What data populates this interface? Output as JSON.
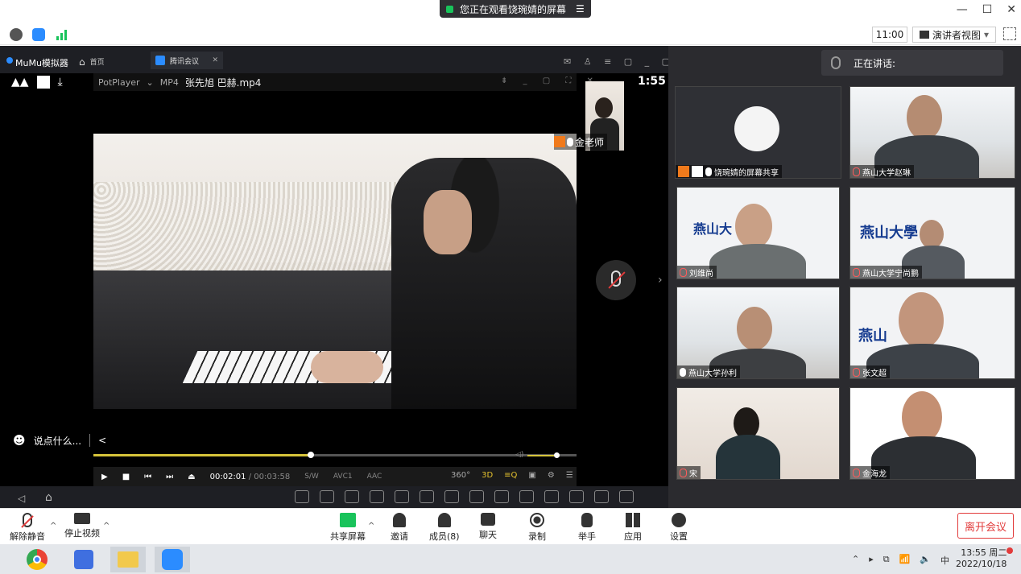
{
  "banner": {
    "text": "您正在观看饶琬婧的屏幕",
    "menu_glyph": "☰"
  },
  "window_controls": {
    "minimize": "—",
    "maximize": "☐",
    "close": "✕"
  },
  "toolbar": {
    "time": "11:00",
    "presenter_view": "演讲者视图",
    "presenter_caret": "▾"
  },
  "mumu": {
    "title": "MuMu模拟器",
    "home_tab": "首页",
    "meeting_tab": "腾讯会议",
    "tab_close": "✕",
    "controls": "✉ ♙ ≡ ▢ _ ▢ ✕"
  },
  "potplayer": {
    "app": "PotPlayer",
    "caret": "⌄",
    "format": "MP4",
    "file_title": "张先旭 巴赫.mp4",
    "controls": "⇟ _ ▢ ⛶ ✕"
  },
  "phone": {
    "clock": "1:55"
  },
  "teacher": {
    "name": "金老师"
  },
  "chat": {
    "placeholder": "说点什么...",
    "arrow": "<"
  },
  "playback": {
    "progress": 0.45,
    "volume": 0.9,
    "current_time": "00:02:01",
    "duration": "/ 00:03:58",
    "tags": [
      "S/W",
      "AVC1",
      "AAC"
    ],
    "right_icons": [
      "360°",
      "3D",
      "≡Q",
      "▣",
      "⚙",
      "☰"
    ]
  },
  "android_nav": {
    "back": "◁",
    "home": "⌂"
  },
  "right_panel": {
    "speaking_label": "正在讲话:",
    "tiles": [
      {
        "name": "饶琬婧的屏幕共享",
        "mic": "on"
      },
      {
        "name": "燕山大学赵琳",
        "mic": "off"
      },
      {
        "name": "刘维尚",
        "mic": "off",
        "logo": "燕山大"
      },
      {
        "name": "燕山大学宁尚鹏",
        "mic": "off",
        "logo": "燕山大學"
      },
      {
        "name": "燕山大学孙利",
        "mic": "on"
      },
      {
        "name": "张文超",
        "mic": "off",
        "logo": "燕山"
      },
      {
        "name": "宋",
        "mic": "off"
      },
      {
        "name": "金海龙",
        "mic": "off"
      }
    ]
  },
  "meeting_bar": {
    "unmute": "解除静音",
    "stop_video": "停止视频",
    "share_screen": "共享屏幕",
    "invite": "邀请",
    "members": "成员(8)",
    "chat": "聊天",
    "record": "录制",
    "raise_hand": "举手",
    "apps": "应用",
    "settings": "设置",
    "leave": "离开会议"
  },
  "taskbar": {
    "tray": [
      "⌃",
      "▸",
      "⧉",
      "📶",
      "🔈",
      "中"
    ],
    "time": "13:55 周二",
    "date": "2022/10/18"
  },
  "colors": {
    "accent_green": "#19c35b",
    "leave_red": "#e23b3b",
    "brand_blue": "#2b8cff",
    "seek_yellow": "#d6c43a"
  }
}
